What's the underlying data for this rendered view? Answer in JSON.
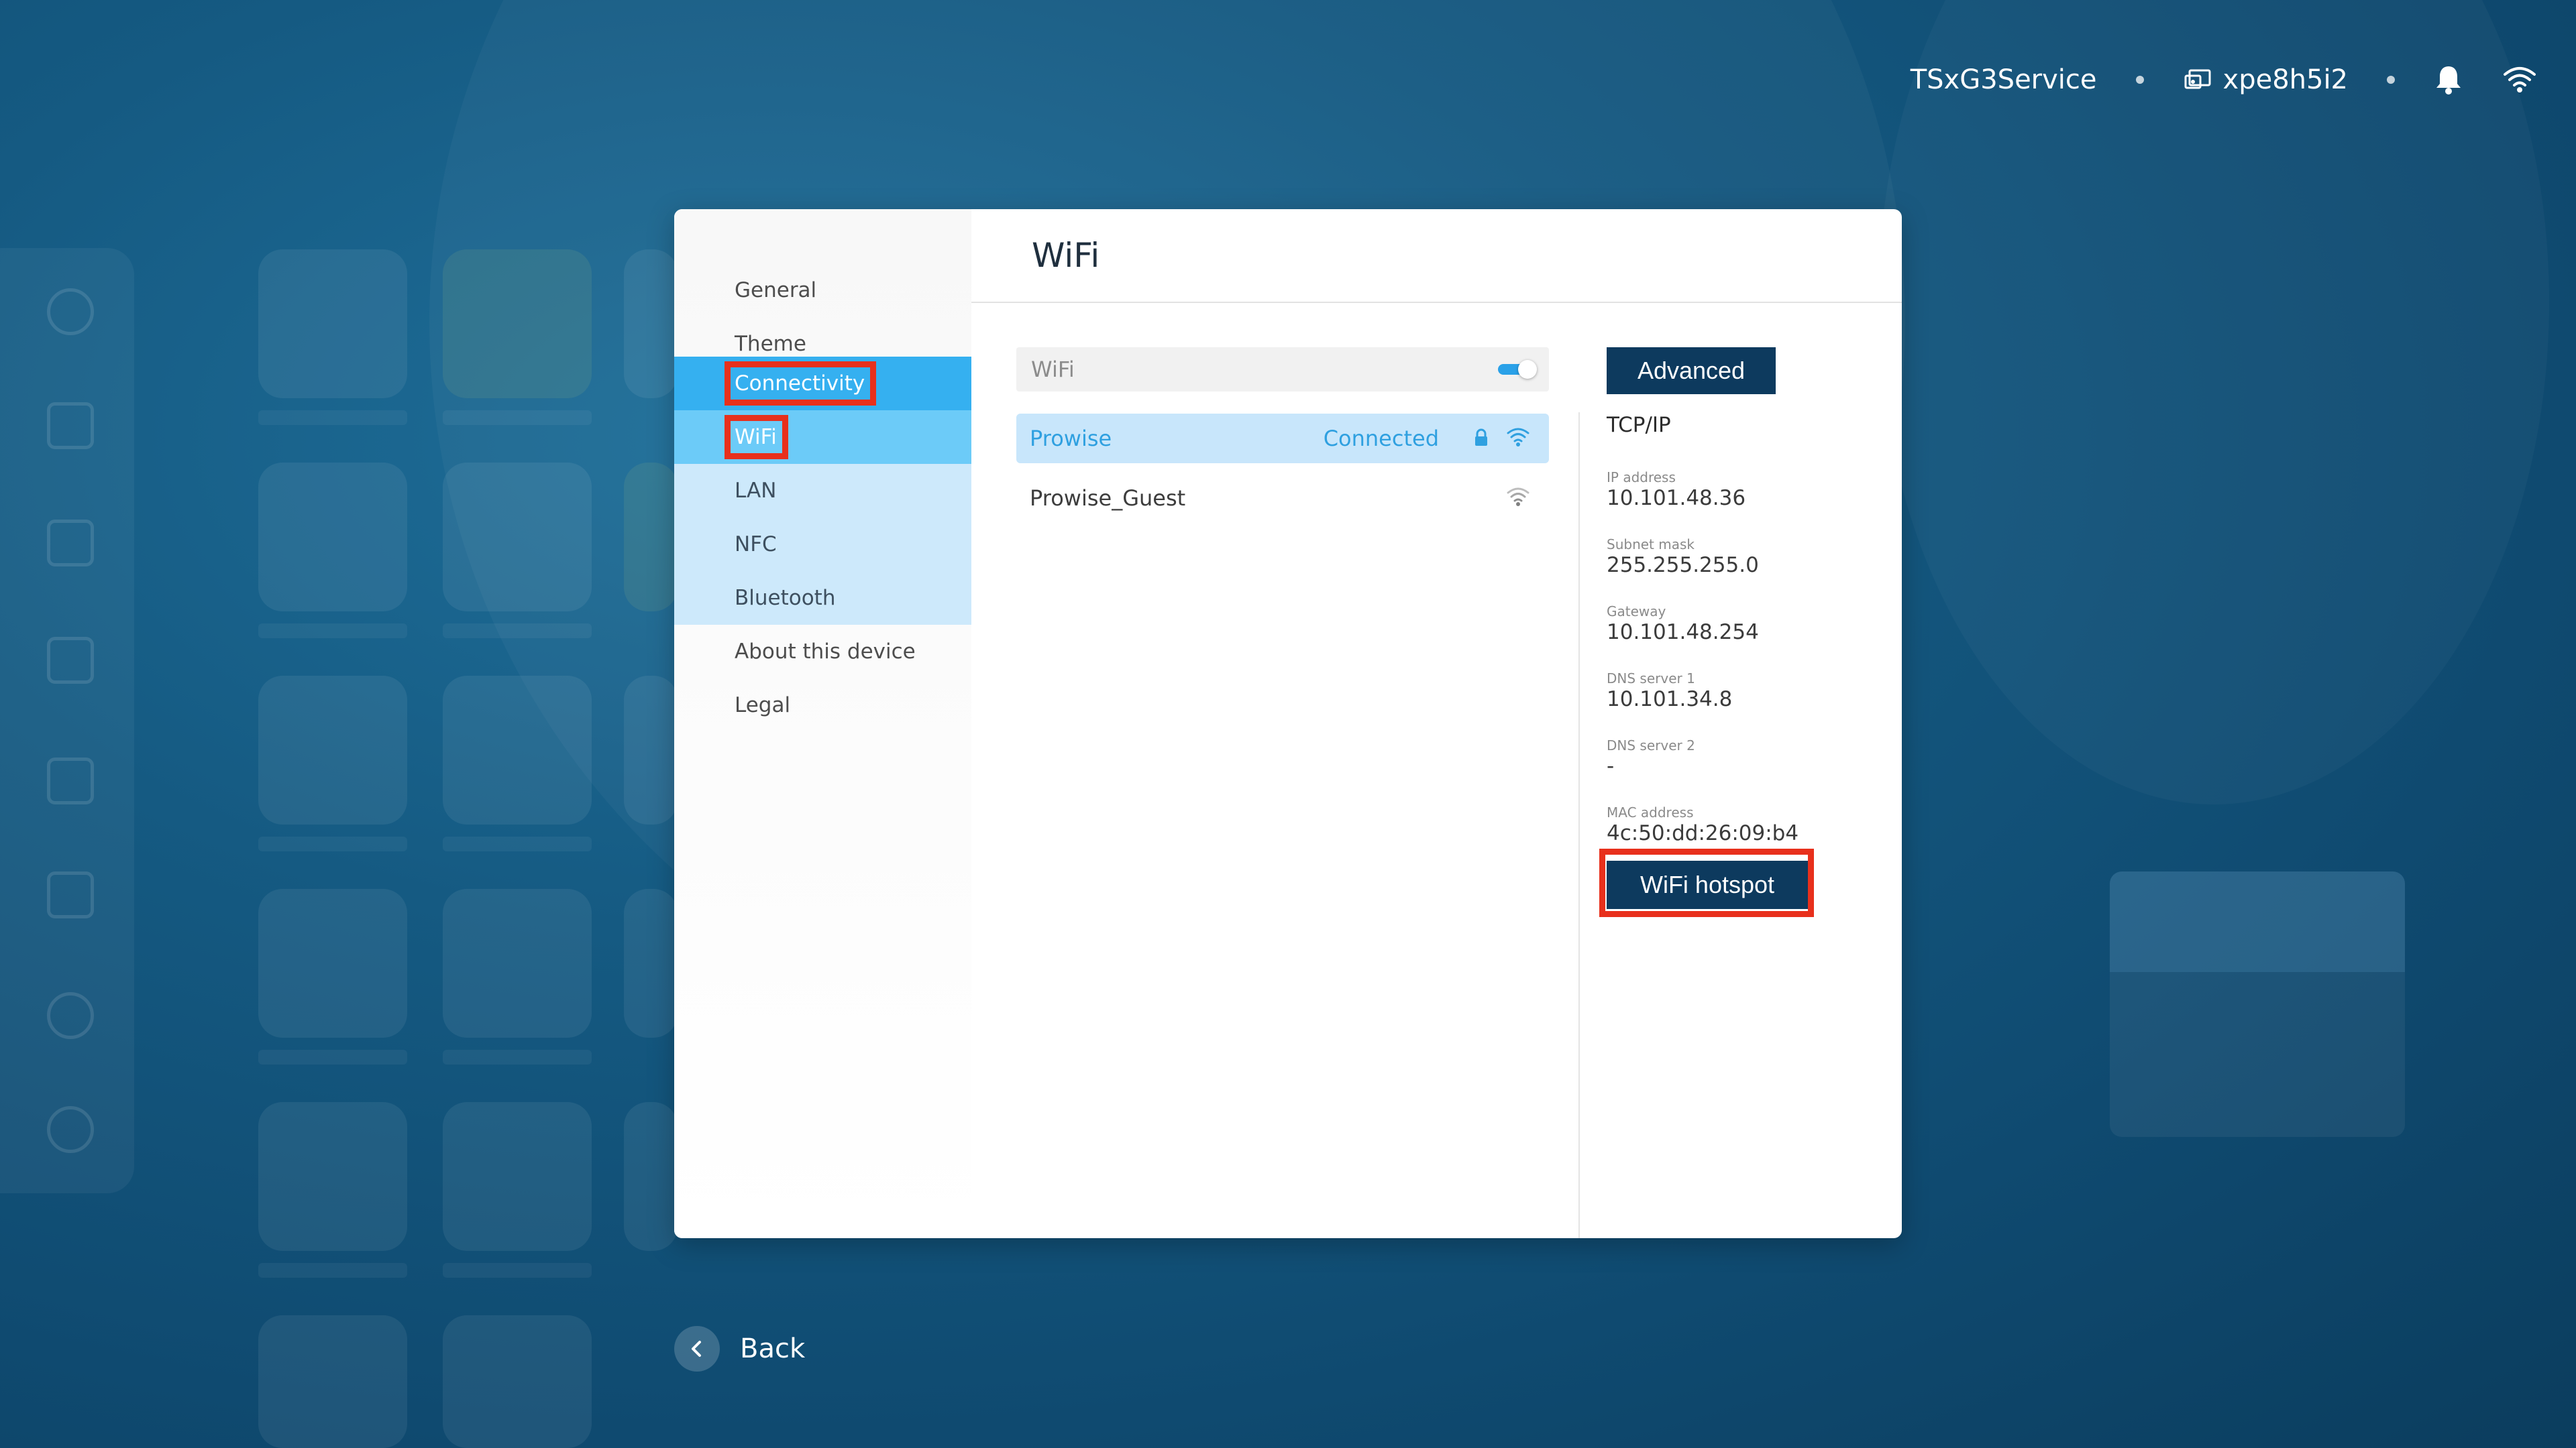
{
  "status_bar": {
    "service_name": "TSxG3Service",
    "device_code": "xpe8h5i2",
    "icons": [
      "cast-icon",
      "bell-icon",
      "wifi-icon"
    ]
  },
  "dialog": {
    "title": "WiFi",
    "sidebar": {
      "items": [
        {
          "label": "General"
        },
        {
          "label": "Theme"
        },
        {
          "label": "Connectivity"
        },
        {
          "label": "WiFi"
        },
        {
          "label": "LAN"
        },
        {
          "label": "NFC"
        },
        {
          "label": "Bluetooth"
        },
        {
          "label": "About this device"
        },
        {
          "label": "Legal"
        }
      ]
    },
    "wifi_toggle": {
      "label": "WiFi",
      "enabled": true
    },
    "networks": [
      {
        "name": "Prowise",
        "status": "Connected",
        "secured": true,
        "signal_icon": "wifi-signal-icon"
      },
      {
        "name": "Prowise_Guest",
        "status": "",
        "secured": false,
        "signal_icon": "wifi-signal-icon"
      }
    ],
    "advanced_button": "Advanced",
    "tcpip": {
      "title": "TCP/IP",
      "fields": [
        {
          "label": "IP address",
          "value": "10.101.48.36"
        },
        {
          "label": "Subnet mask",
          "value": "255.255.255.0"
        },
        {
          "label": "Gateway",
          "value": "10.101.48.254"
        },
        {
          "label": "DNS server 1",
          "value": "10.101.34.8"
        },
        {
          "label": "DNS server 2",
          "value": "-"
        },
        {
          "label": "MAC address",
          "value": "4c:50:dd:26:09:b4"
        }
      ]
    },
    "hotspot_button": "WiFi hotspot"
  },
  "back": {
    "label": "Back"
  },
  "colors": {
    "accent": "#35b0f0",
    "sub_active": "#6ccbf8",
    "sub_bg": "#cde9fb",
    "button_dark": "#0d3a5e",
    "highlight": "#e8301c"
  }
}
